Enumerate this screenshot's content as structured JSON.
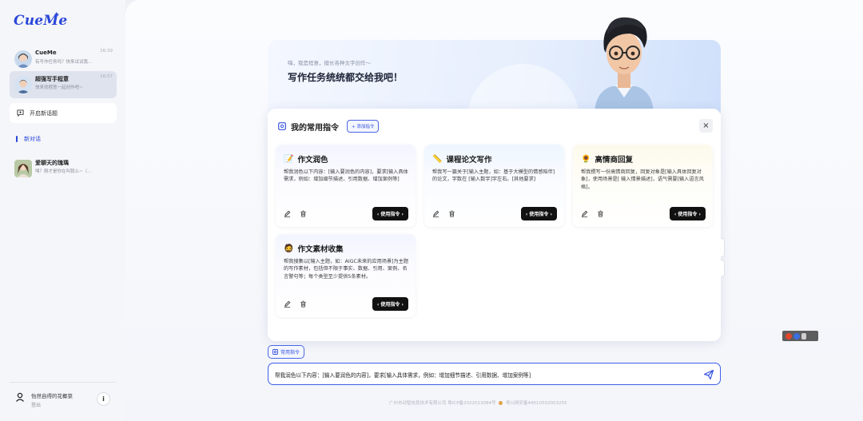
{
  "app": {
    "logo": "CueMe"
  },
  "sidebar": {
    "chats": [
      {
        "name": "CueMe",
        "preview": "有写作任务吗？快来试试我...",
        "time": "16:39"
      },
      {
        "name": "超强写手程意",
        "preview": "快来找程意一起创作吧~",
        "time": "16:57"
      }
    ],
    "new_topic": "开启新话题",
    "section_label": "新对话",
    "history": [
      {
        "name": "爱聊天的瑰瑀",
        "preview": "嘿？刚才是你在叫我么~（..."
      }
    ],
    "user": {
      "name": "怡然自得的花椰菜",
      "logout": "登出"
    },
    "info_icon": "i"
  },
  "hero": {
    "subtitle": "嗨，我是程意，擅长各种文字创作～",
    "title": "写作任务统统都交给我吧！"
  },
  "panel": {
    "title": "我的常用指令",
    "add_button": "+ 添加指令",
    "close": "×",
    "cards": [
      {
        "title": "作文润色",
        "emoji": "📝",
        "desc": "帮我润色以下内容：[输入要润色的内容]，要求[输入具体需求，例如：增加细节描述、引用数据、增加案例等]",
        "use": "‹ 使用指令 ›"
      },
      {
        "title": "课程论文写作",
        "emoji": "📏",
        "desc": "帮我写一篇关于[输入主题，如：基于大模型的情感陪伴]的论文，字数在 [输入数字]字左右。[其他要求]",
        "use": "‹ 使用指令 ›"
      },
      {
        "title": "高情商回复",
        "emoji": "🌻",
        "desc": "帮我撰写一份高情商回复，回复对象是[输入具体回复对象]，使用场景是[ 输入情景描述]，语气需要[输入语言风格]。",
        "use": "‹ 使用指令 ›"
      },
      {
        "title": "作文素材收集",
        "emoji": "🧔",
        "desc": "帮我搜集以[输入主题，如：AIGC未来的应用场景]为主题的写作素材，包括但不限于事实、数据、引用、案例、名言警句等；每个类型至少提供5条素材。",
        "use": "‹ 使用指令 ›"
      }
    ]
  },
  "chip": {
    "label": "常用指令"
  },
  "input": {
    "value": "帮我润色以下内容：[输入要润色的内容]，要求[输入具体需求，例如：增加细节描述、引用数据、增加案例等]"
  },
  "footer": {
    "icp": "广州市动智信息技术有限公司 粤ICP备2022013084号",
    "police": "粤公网安备44010502003255"
  },
  "colors": {
    "accent": "#2b47d9",
    "button": "#111111"
  }
}
